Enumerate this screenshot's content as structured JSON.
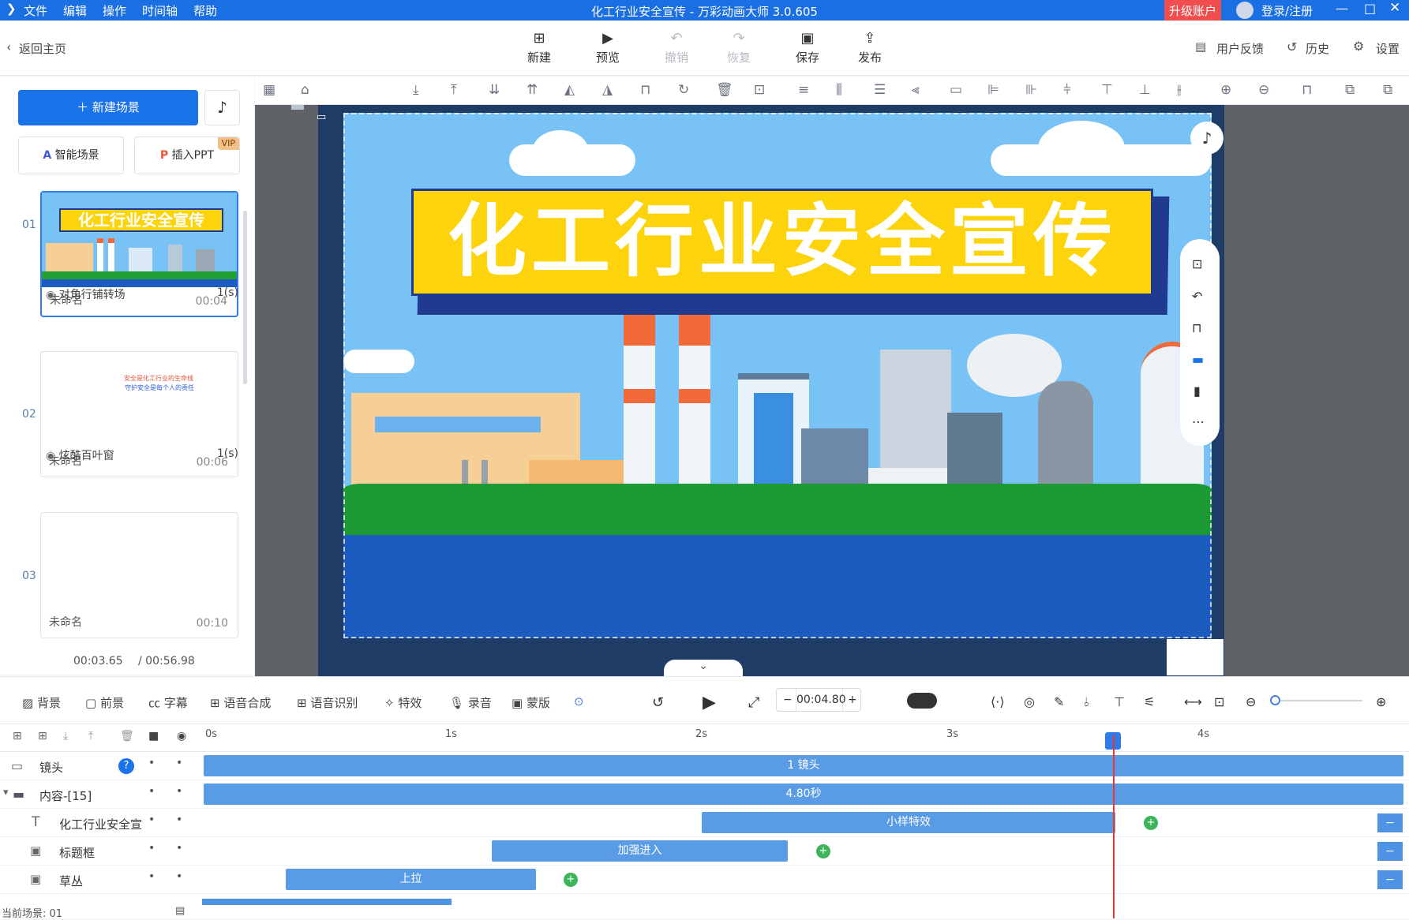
{
  "titlebar": {
    "menu": [
      "文件",
      "编辑",
      "操作",
      "时间轴",
      "帮助"
    ],
    "title": "化工行业安全宣传 - 万彩动画大师 3.0.605",
    "upgrade": "升级账户",
    "login": "登录/注册",
    "color": "#1a6fe3"
  },
  "toolbar": {
    "back": "返回主页",
    "buttons": [
      {
        "label": "新建",
        "icon": "plus-square-icon"
      },
      {
        "label": "预览",
        "icon": "play-icon"
      },
      {
        "label": "撤销",
        "icon": "undo-icon"
      },
      {
        "label": "恢复",
        "icon": "redo-icon"
      },
      {
        "label": "保存",
        "icon": "save-icon"
      },
      {
        "label": "发布",
        "icon": "publish-icon"
      }
    ],
    "feedback": "用户反馈",
    "history": "历史",
    "settings": "设置"
  },
  "left": {
    "new_scene": "新建场景",
    "smart_scene": "智能场景",
    "insert_ppt": "插入PPT",
    "vip": "VIP",
    "scenes": [
      {
        "num": "01",
        "name": "未命名",
        "duration": "00:04",
        "thumb_title": "化工行业安全宣传"
      },
      {
        "num": "02",
        "name": "未命名",
        "duration": "00:06",
        "thumb_text1": "安全是化工行业的生命线",
        "thumb_text2": "守护安全是每个人的责任"
      },
      {
        "num": "03",
        "name": "未命名",
        "duration": "00:10"
      }
    ],
    "transitions": [
      {
        "name": "对角行铺转场",
        "time": "1(s)"
      },
      {
        "name": "炫酷百叶窗",
        "time": "1(s)"
      }
    ],
    "current_time": "00:03.65",
    "total_time": "/ 00:56.98"
  },
  "stage": {
    "banner_title": "化工行业安全宣传",
    "sky_color": "#78c2f5",
    "banner_color": "#fdd40c",
    "water_color": "#1c5bbf"
  },
  "timeline_tools": {
    "items": [
      "背景",
      "前景",
      "字幕",
      "语音合成",
      "语音识别",
      "特效",
      "录音",
      "蒙版"
    ],
    "time_value": "00:04.80"
  },
  "ruler": {
    "ticks": [
      "0s",
      "1s",
      "2s",
      "3s",
      "4s"
    ]
  },
  "tracks": [
    {
      "label": "镜头",
      "bar": "1 镜头"
    },
    {
      "label": "内容-[15]",
      "bar": "4.80秒"
    },
    {
      "label": "化工行业安全宣",
      "bar": "小样特效"
    },
    {
      "label": "标题框",
      "bar": "加强进入"
    },
    {
      "label": "草丛",
      "bar": "上拉"
    }
  ],
  "status": {
    "current_scene": "当前场景: 01"
  }
}
